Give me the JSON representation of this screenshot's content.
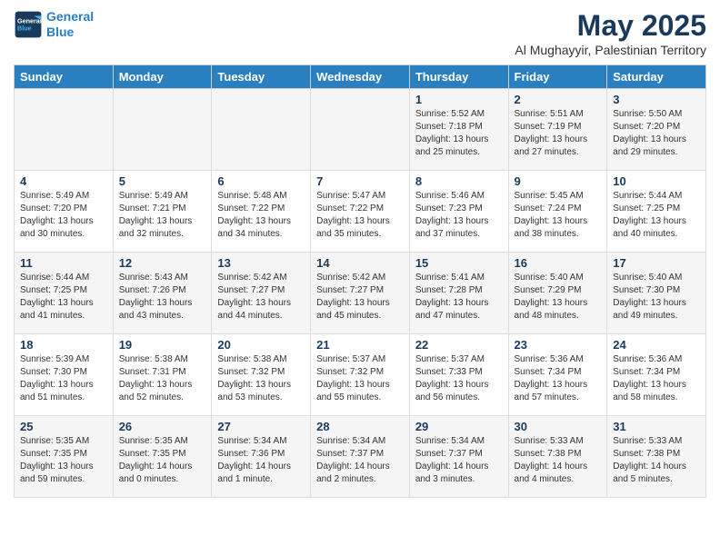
{
  "header": {
    "logo_line1": "General",
    "logo_line2": "Blue",
    "title": "May 2025",
    "subtitle": "Al Mughayyir, Palestinian Territory"
  },
  "days_of_week": [
    "Sunday",
    "Monday",
    "Tuesday",
    "Wednesday",
    "Thursday",
    "Friday",
    "Saturday"
  ],
  "weeks": [
    [
      {
        "day": "",
        "sunrise": "",
        "sunset": "",
        "daylight": ""
      },
      {
        "day": "",
        "sunrise": "",
        "sunset": "",
        "daylight": ""
      },
      {
        "day": "",
        "sunrise": "",
        "sunset": "",
        "daylight": ""
      },
      {
        "day": "",
        "sunrise": "",
        "sunset": "",
        "daylight": ""
      },
      {
        "day": "1",
        "sunrise": "Sunrise: 5:52 AM",
        "sunset": "Sunset: 7:18 PM",
        "daylight": "Daylight: 13 hours and 25 minutes."
      },
      {
        "day": "2",
        "sunrise": "Sunrise: 5:51 AM",
        "sunset": "Sunset: 7:19 PM",
        "daylight": "Daylight: 13 hours and 27 minutes."
      },
      {
        "day": "3",
        "sunrise": "Sunrise: 5:50 AM",
        "sunset": "Sunset: 7:20 PM",
        "daylight": "Daylight: 13 hours and 29 minutes."
      }
    ],
    [
      {
        "day": "4",
        "sunrise": "Sunrise: 5:49 AM",
        "sunset": "Sunset: 7:20 PM",
        "daylight": "Daylight: 13 hours and 30 minutes."
      },
      {
        "day": "5",
        "sunrise": "Sunrise: 5:49 AM",
        "sunset": "Sunset: 7:21 PM",
        "daylight": "Daylight: 13 hours and 32 minutes."
      },
      {
        "day": "6",
        "sunrise": "Sunrise: 5:48 AM",
        "sunset": "Sunset: 7:22 PM",
        "daylight": "Daylight: 13 hours and 34 minutes."
      },
      {
        "day": "7",
        "sunrise": "Sunrise: 5:47 AM",
        "sunset": "Sunset: 7:22 PM",
        "daylight": "Daylight: 13 hours and 35 minutes."
      },
      {
        "day": "8",
        "sunrise": "Sunrise: 5:46 AM",
        "sunset": "Sunset: 7:23 PM",
        "daylight": "Daylight: 13 hours and 37 minutes."
      },
      {
        "day": "9",
        "sunrise": "Sunrise: 5:45 AM",
        "sunset": "Sunset: 7:24 PM",
        "daylight": "Daylight: 13 hours and 38 minutes."
      },
      {
        "day": "10",
        "sunrise": "Sunrise: 5:44 AM",
        "sunset": "Sunset: 7:25 PM",
        "daylight": "Daylight: 13 hours and 40 minutes."
      }
    ],
    [
      {
        "day": "11",
        "sunrise": "Sunrise: 5:44 AM",
        "sunset": "Sunset: 7:25 PM",
        "daylight": "Daylight: 13 hours and 41 minutes."
      },
      {
        "day": "12",
        "sunrise": "Sunrise: 5:43 AM",
        "sunset": "Sunset: 7:26 PM",
        "daylight": "Daylight: 13 hours and 43 minutes."
      },
      {
        "day": "13",
        "sunrise": "Sunrise: 5:42 AM",
        "sunset": "Sunset: 7:27 PM",
        "daylight": "Daylight: 13 hours and 44 minutes."
      },
      {
        "day": "14",
        "sunrise": "Sunrise: 5:42 AM",
        "sunset": "Sunset: 7:27 PM",
        "daylight": "Daylight: 13 hours and 45 minutes."
      },
      {
        "day": "15",
        "sunrise": "Sunrise: 5:41 AM",
        "sunset": "Sunset: 7:28 PM",
        "daylight": "Daylight: 13 hours and 47 minutes."
      },
      {
        "day": "16",
        "sunrise": "Sunrise: 5:40 AM",
        "sunset": "Sunset: 7:29 PM",
        "daylight": "Daylight: 13 hours and 48 minutes."
      },
      {
        "day": "17",
        "sunrise": "Sunrise: 5:40 AM",
        "sunset": "Sunset: 7:30 PM",
        "daylight": "Daylight: 13 hours and 49 minutes."
      }
    ],
    [
      {
        "day": "18",
        "sunrise": "Sunrise: 5:39 AM",
        "sunset": "Sunset: 7:30 PM",
        "daylight": "Daylight: 13 hours and 51 minutes."
      },
      {
        "day": "19",
        "sunrise": "Sunrise: 5:38 AM",
        "sunset": "Sunset: 7:31 PM",
        "daylight": "Daylight: 13 hours and 52 minutes."
      },
      {
        "day": "20",
        "sunrise": "Sunrise: 5:38 AM",
        "sunset": "Sunset: 7:32 PM",
        "daylight": "Daylight: 13 hours and 53 minutes."
      },
      {
        "day": "21",
        "sunrise": "Sunrise: 5:37 AM",
        "sunset": "Sunset: 7:32 PM",
        "daylight": "Daylight: 13 hours and 55 minutes."
      },
      {
        "day": "22",
        "sunrise": "Sunrise: 5:37 AM",
        "sunset": "Sunset: 7:33 PM",
        "daylight": "Daylight: 13 hours and 56 minutes."
      },
      {
        "day": "23",
        "sunrise": "Sunrise: 5:36 AM",
        "sunset": "Sunset: 7:34 PM",
        "daylight": "Daylight: 13 hours and 57 minutes."
      },
      {
        "day": "24",
        "sunrise": "Sunrise: 5:36 AM",
        "sunset": "Sunset: 7:34 PM",
        "daylight": "Daylight: 13 hours and 58 minutes."
      }
    ],
    [
      {
        "day": "25",
        "sunrise": "Sunrise: 5:35 AM",
        "sunset": "Sunset: 7:35 PM",
        "daylight": "Daylight: 13 hours and 59 minutes."
      },
      {
        "day": "26",
        "sunrise": "Sunrise: 5:35 AM",
        "sunset": "Sunset: 7:35 PM",
        "daylight": "Daylight: 14 hours and 0 minutes."
      },
      {
        "day": "27",
        "sunrise": "Sunrise: 5:34 AM",
        "sunset": "Sunset: 7:36 PM",
        "daylight": "Daylight: 14 hours and 1 minute."
      },
      {
        "day": "28",
        "sunrise": "Sunrise: 5:34 AM",
        "sunset": "Sunset: 7:37 PM",
        "daylight": "Daylight: 14 hours and 2 minutes."
      },
      {
        "day": "29",
        "sunrise": "Sunrise: 5:34 AM",
        "sunset": "Sunset: 7:37 PM",
        "daylight": "Daylight: 14 hours and 3 minutes."
      },
      {
        "day": "30",
        "sunrise": "Sunrise: 5:33 AM",
        "sunset": "Sunset: 7:38 PM",
        "daylight": "Daylight: 14 hours and 4 minutes."
      },
      {
        "day": "31",
        "sunrise": "Sunrise: 5:33 AM",
        "sunset": "Sunset: 7:38 PM",
        "daylight": "Daylight: 14 hours and 5 minutes."
      }
    ]
  ]
}
